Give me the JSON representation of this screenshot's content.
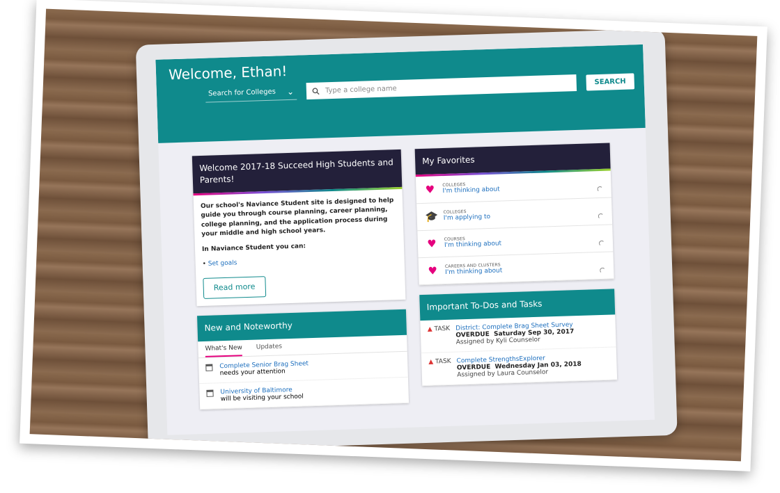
{
  "header": {
    "welcome": "Welcome, Ethan!",
    "search_type": "Search for Colleges",
    "search_placeholder": "Type a college name",
    "search_button": "SEARCH"
  },
  "welcome_card": {
    "title": "Welcome 2017-18 Succeed High Students and Parents!",
    "intro": "Our school's Naviance Student site is designed to help guide you through course planning, career planning, college planning, and the application process during your middle and high school years.",
    "subhead": "In Naviance Student you can:",
    "bullet": "Set goals",
    "read_more": "Read more"
  },
  "news": {
    "title": "New and Noteworthy",
    "tabs": [
      "What's New",
      "Updates"
    ],
    "items": [
      {
        "link": "Complete Senior Brag Sheet",
        "text": "needs your attention"
      },
      {
        "link": "University of Baltimore",
        "text": "will be visiting your school"
      }
    ]
  },
  "favorites": {
    "title": "My Favorites",
    "items": [
      {
        "category": "COLLEGES",
        "label": "I'm thinking about",
        "icon": "heart-icon"
      },
      {
        "category": "COLLEGES",
        "label": "I'm applying to",
        "icon": "graduation-cap-icon"
      },
      {
        "category": "COURSES",
        "label": "I'm thinking about",
        "icon": "heart-icon"
      },
      {
        "category": "CAREERS AND CLUSTERS",
        "label": "I'm thinking about",
        "icon": "heart-icon"
      }
    ]
  },
  "tasks": {
    "title": "Important To-Dos and Tasks",
    "items": [
      {
        "tag": "TASK",
        "link": "District: Complete Brag Sheet Survey",
        "status": "OVERDUE",
        "date": "Saturday Sep 30, 2017",
        "assigned": "Assigned by Kyli Counselor"
      },
      {
        "tag": "TASK",
        "link": "Complete StrengthsExplorer",
        "status": "OVERDUE",
        "date": "Wednesday Jan 03, 2018",
        "assigned": "Assigned by Laura Counselor"
      }
    ]
  },
  "colors": {
    "teal": "#0f8a8c",
    "navy": "#23203a",
    "pink": "#e5007e"
  }
}
